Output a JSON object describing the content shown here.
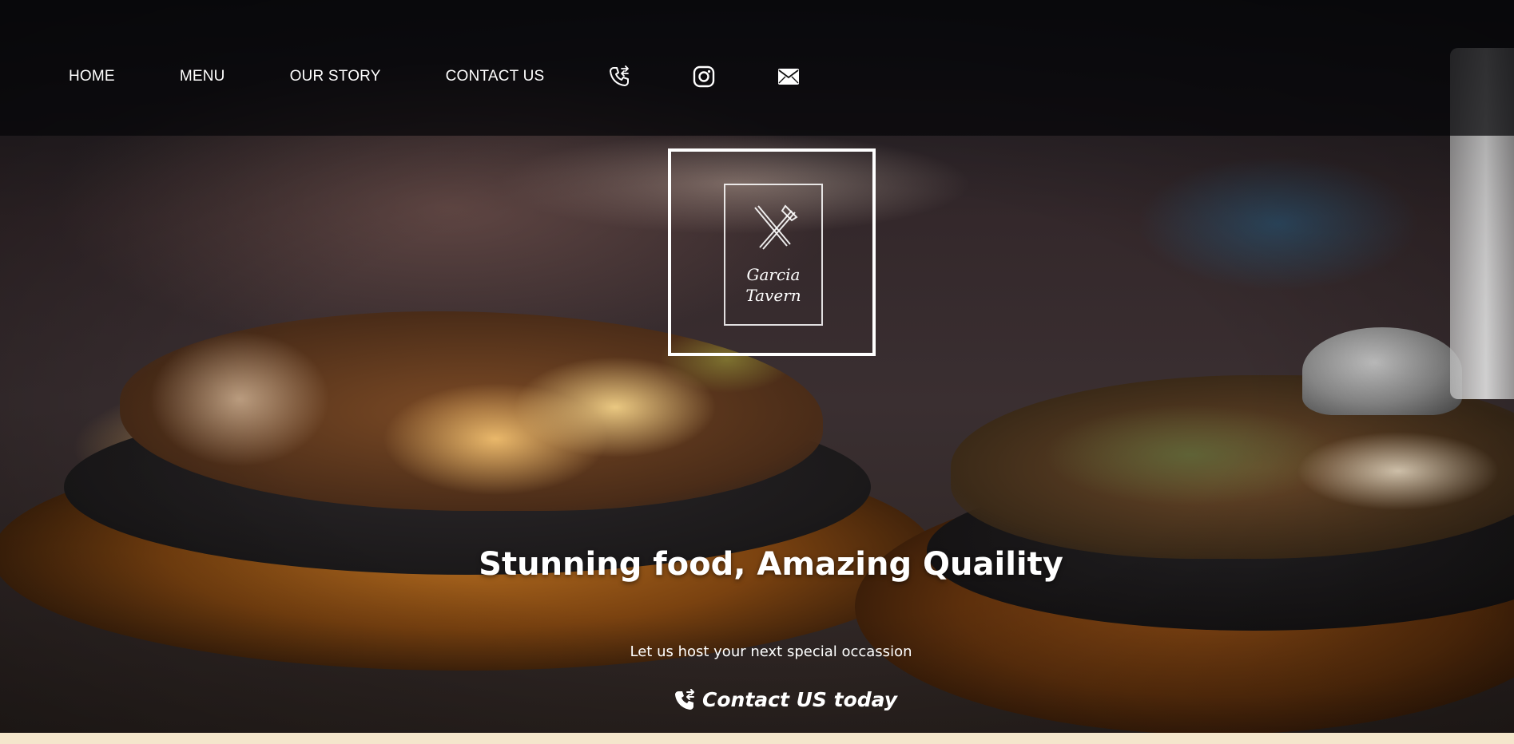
{
  "nav": {
    "links": [
      {
        "label": "HOME"
      },
      {
        "label": "MENU"
      },
      {
        "label": "OUR STORY"
      },
      {
        "label": "CONTACT US"
      }
    ],
    "icons": [
      "phone-icon",
      "instagram-icon",
      "mail-icon"
    ]
  },
  "logo": {
    "line1": "Garcia",
    "line2": "Tavern"
  },
  "hero": {
    "headline": "Stunning food, Amazing Quaility",
    "subline": "Let us host your next special occassion",
    "cta_label": "Contact US today",
    "cta_icon": "phone-icon"
  },
  "colors": {
    "nav_bar": "#050508",
    "text": "#ffffff",
    "footer_strip": "#f4e6cc"
  }
}
